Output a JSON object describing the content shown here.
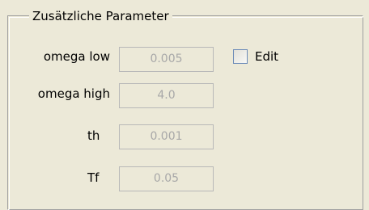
{
  "group": {
    "title": "Zusätzliche Parameter"
  },
  "params": [
    {
      "label": "omega low",
      "value": "0.005"
    },
    {
      "label": "omega high",
      "value": "4.0"
    },
    {
      "label": "th",
      "value": "0.001"
    },
    {
      "label": "Tf",
      "value": "0.05"
    }
  ],
  "edit": {
    "label": "Edit",
    "checked": false
  },
  "colors": {
    "panel_bg": "#ece9d8",
    "field_border": "#b8b8b8",
    "disabled_text": "#a8a8a8",
    "checkbox_border": "#6c8bb8"
  }
}
